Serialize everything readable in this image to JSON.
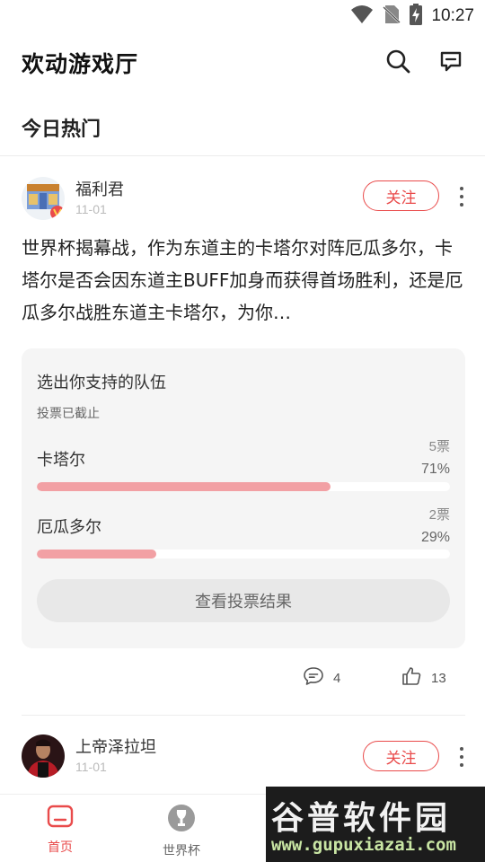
{
  "status_bar": {
    "time": "10:27",
    "icons": [
      "wifi-icon",
      "no-sim-icon",
      "battery-charging-icon"
    ]
  },
  "header": {
    "title": "欢动游戏厅",
    "icons": [
      "search-icon",
      "message-icon"
    ]
  },
  "section": {
    "title": "今日热门"
  },
  "posts": [
    {
      "author": "福利君",
      "date": "11-01",
      "follow_label": "关注",
      "text": "世界杯揭幕战，作为东道主的卡塔尔对阵厄瓜多尔，卡塔尔是否会因东道主BUFF加身而获得首场胜利，还是厄瓜多尔战胜东道主卡塔尔，为你…",
      "vote": {
        "title": "选出你支持的队伍",
        "status": "投票已截止",
        "options": [
          {
            "name": "卡塔尔",
            "votes": "5票",
            "percent": "71%",
            "fraction": 0.71
          },
          {
            "name": "厄瓜多尔",
            "votes": "2票",
            "percent": "29%",
            "fraction": 0.29
          }
        ],
        "result_button": "查看投票结果"
      },
      "comments": "4",
      "likes": "13"
    },
    {
      "author": "上帝泽拉坦",
      "date": "11-01",
      "follow_label": "关注"
    }
  ],
  "bottom_nav": [
    {
      "label": "首页",
      "icon": "home-icon",
      "active": true
    },
    {
      "label": "世界杯",
      "icon": "world-cup-trophy-icon",
      "active": false
    }
  ],
  "watermark": {
    "main": "谷普软件园",
    "url": "www.gupuxiazai.com"
  },
  "colors": {
    "accent": "#e94b4b",
    "bar_fill": "#f2a0a4",
    "card_bg": "#f5f5f5"
  }
}
